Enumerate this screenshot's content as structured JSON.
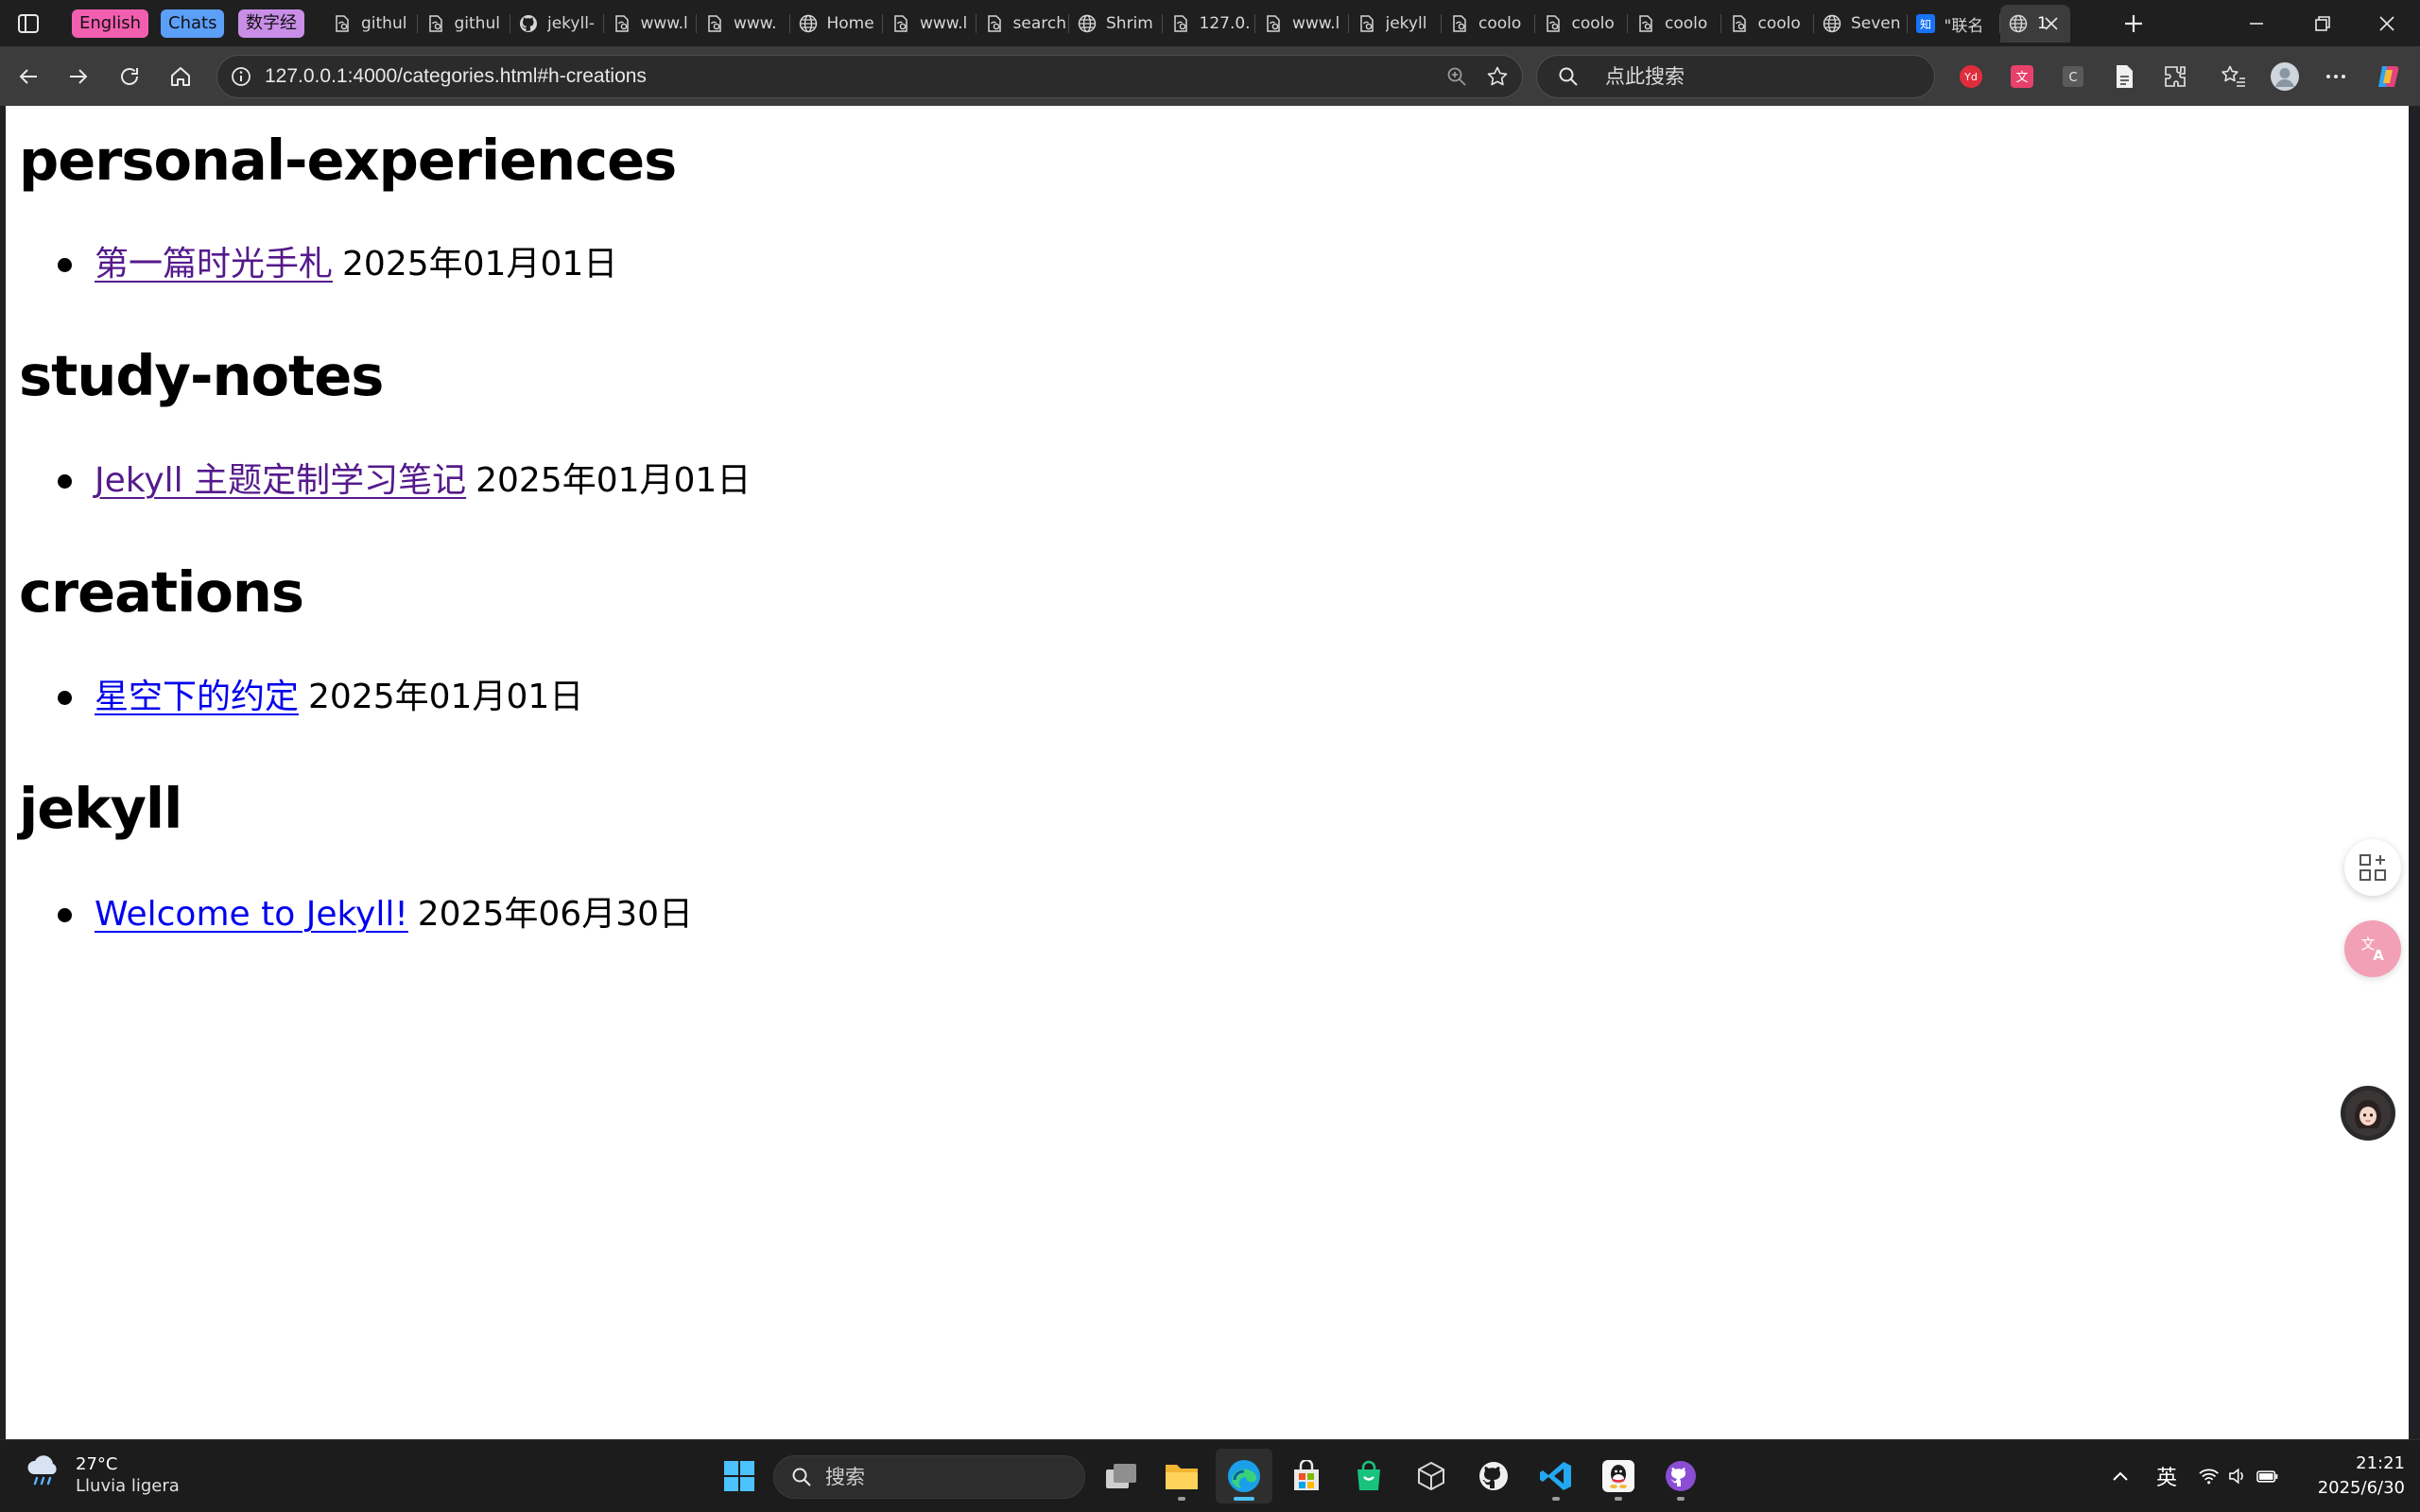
{
  "tab_groups": [
    {
      "label": "English",
      "color": "#f25fb0"
    },
    {
      "label": "Chats",
      "color": "#5b9ff8"
    },
    {
      "label": "数字经",
      "color": "#c98ee8"
    }
  ],
  "tabs": [
    {
      "title": "githul",
      "icon": "page-icon"
    },
    {
      "title": "githul",
      "icon": "page-icon"
    },
    {
      "title": "jekyll-",
      "icon": "github-icon"
    },
    {
      "title": "www.l",
      "icon": "page-icon"
    },
    {
      "title": "www.",
      "icon": "page-icon"
    },
    {
      "title": "Home",
      "icon": "globe-icon"
    },
    {
      "title": "www.l",
      "icon": "page-icon"
    },
    {
      "title": "search",
      "icon": "page-icon"
    },
    {
      "title": "Shrim",
      "icon": "globe-icon"
    },
    {
      "title": "127.0.",
      "icon": "page-icon"
    },
    {
      "title": "www.l",
      "icon": "page-icon"
    },
    {
      "title": "jekyll",
      "icon": "page-icon"
    },
    {
      "title": "coolo",
      "icon": "page-icon"
    },
    {
      "title": "coolo",
      "icon": "page-icon"
    },
    {
      "title": "coolo",
      "icon": "page-icon"
    },
    {
      "title": "coolo",
      "icon": "page-icon"
    },
    {
      "title": "Seven",
      "icon": "globe-icon"
    },
    {
      "title": "\"联名",
      "icon": "zhihu-icon"
    }
  ],
  "active_tab": {
    "title": "1",
    "icon": "globe-icon"
  },
  "toolbar": {
    "url": "127.0.0.1:4000/categories.html#h-creations",
    "search_placeholder": "点此搜索"
  },
  "page": {
    "categories": [
      {
        "name": "personal-experiences",
        "posts": [
          {
            "title": "第一篇时光手札",
            "date": "2025年01月01日",
            "visited": true
          }
        ]
      },
      {
        "name": "study-notes",
        "posts": [
          {
            "title": "Jekyll 主题定制学习笔记",
            "date": "2025年01月01日",
            "visited": true
          }
        ]
      },
      {
        "name": "creations",
        "posts": [
          {
            "title": "星空下的约定",
            "date": "2025年01月01日",
            "visited": false
          }
        ]
      },
      {
        "name": "jekyll",
        "posts": [
          {
            "title": "Welcome to Jekyll!",
            "date": "2025年06月30日",
            "visited": false
          }
        ]
      }
    ]
  },
  "taskbar": {
    "weather_temp": "27°C",
    "weather_desc": "Lluvia ligera",
    "search_label": "搜索",
    "ime_indicator": "英",
    "time": "21:21",
    "date": "2025/6/30"
  },
  "colors": {
    "visited_link": "#551a8b",
    "unvisited_link": "#0000ee",
    "accent": "#4cc2ff"
  }
}
